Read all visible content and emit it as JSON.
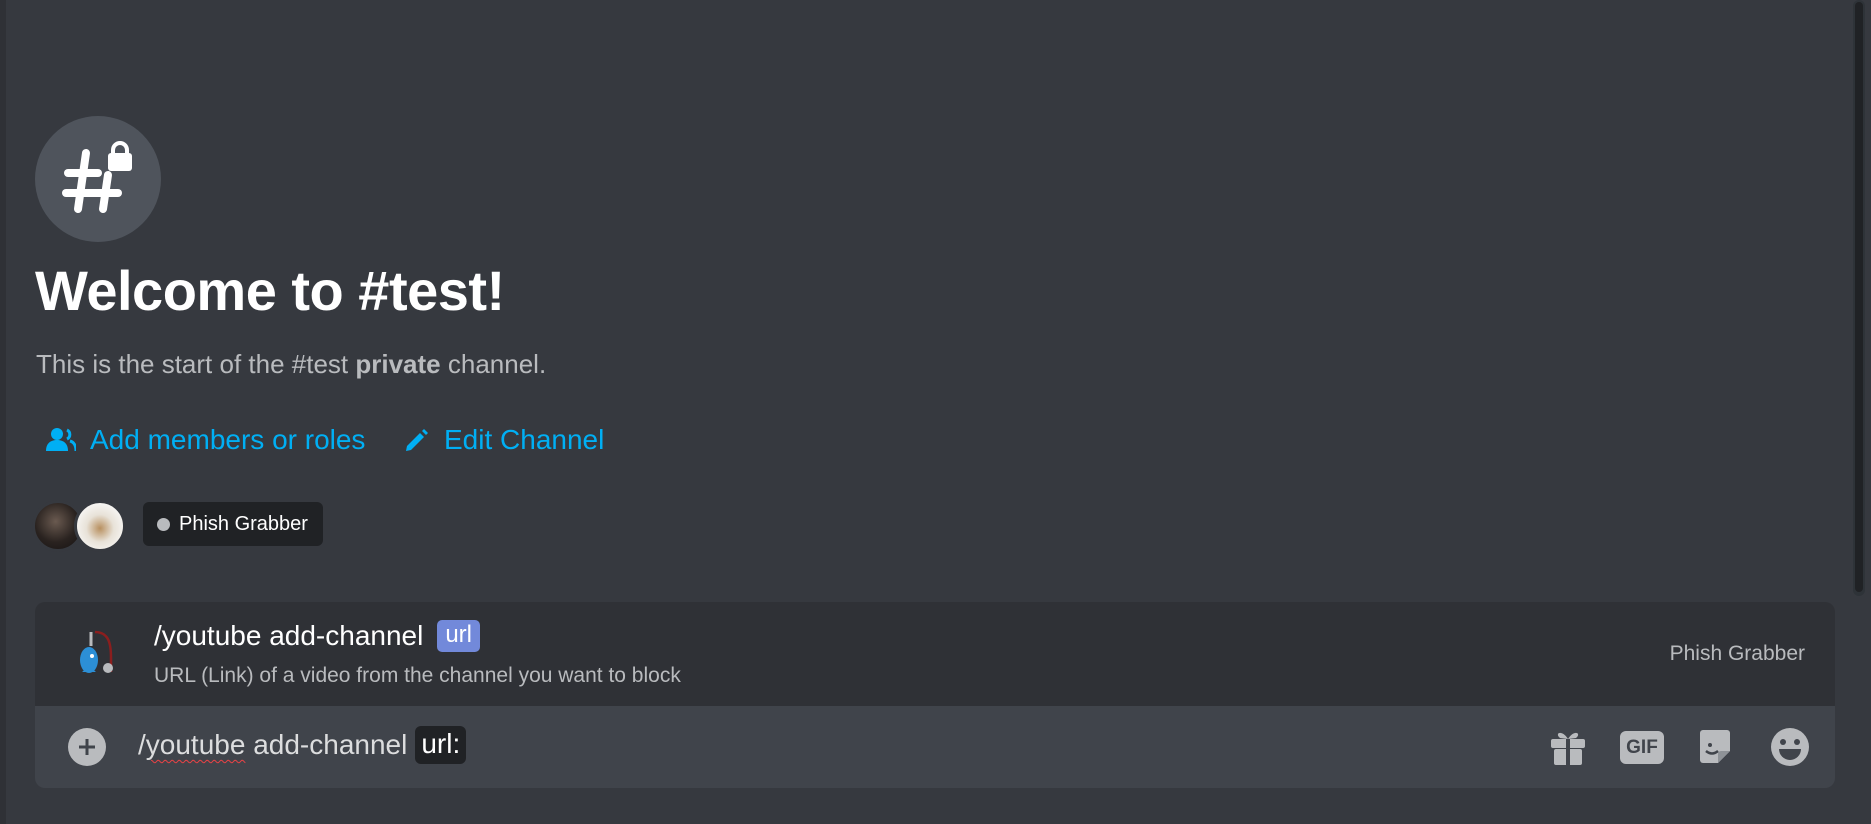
{
  "welcome": {
    "title": "Welcome to #test!",
    "subtitle_prefix": "This is the start of the #test ",
    "subtitle_bold": "private",
    "subtitle_suffix": " channel."
  },
  "actions": {
    "add_members": "Add members or roles",
    "edit_channel": "Edit Channel"
  },
  "members": {
    "bot_name": "Phish Grabber"
  },
  "autocomplete": {
    "command": "/youtube add-channel",
    "param": "url",
    "description": "URL (Link) of a video from the channel you want to block",
    "source": "Phish Grabber"
  },
  "composer": {
    "slash": "/",
    "word_misspelled": "youtube",
    "rest": " add-channel",
    "param_chip": "url:",
    "gif_label": "GIF"
  },
  "colors": {
    "background": "#36393f",
    "link": "#00aff4",
    "param_accent": "#7289da"
  }
}
